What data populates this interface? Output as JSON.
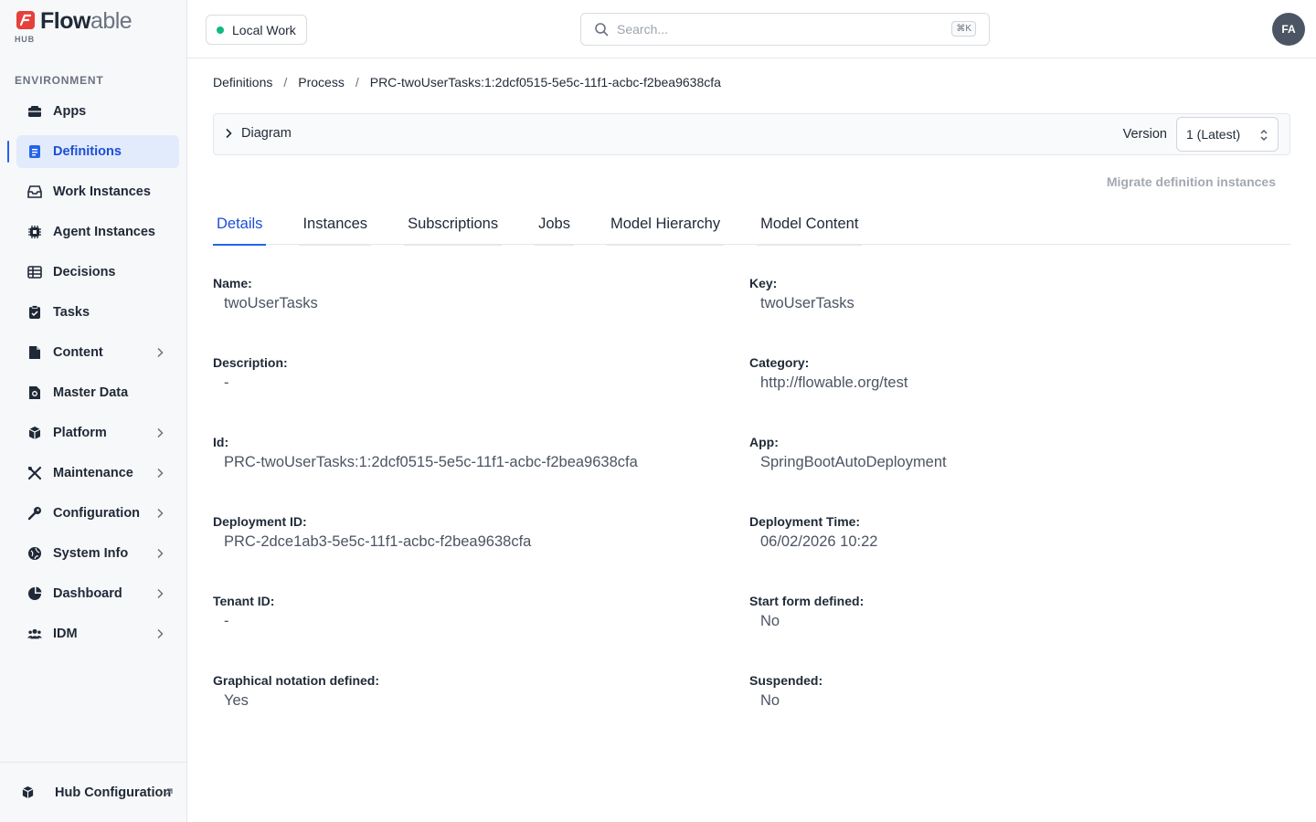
{
  "brand": {
    "name_main": "Flow",
    "name_accent": "able",
    "sub": "HUB"
  },
  "sidebar": {
    "section_label": "ENVIRONMENT",
    "items": [
      {
        "label": "Apps",
        "icon": "apps-icon",
        "active": false,
        "expandable": false
      },
      {
        "label": "Definitions",
        "icon": "definitions-icon",
        "active": true,
        "expandable": false
      },
      {
        "label": "Work Instances",
        "icon": "work-instances-icon",
        "active": false,
        "expandable": false
      },
      {
        "label": "Agent Instances",
        "icon": "agent-instances-icon",
        "active": false,
        "expandable": false
      },
      {
        "label": "Decisions",
        "icon": "decisions-icon",
        "active": false,
        "expandable": false
      },
      {
        "label": "Tasks",
        "icon": "tasks-icon",
        "active": false,
        "expandable": false
      },
      {
        "label": "Content",
        "icon": "content-icon",
        "active": false,
        "expandable": true
      },
      {
        "label": "Master Data",
        "icon": "master-data-icon",
        "active": false,
        "expandable": false
      },
      {
        "label": "Platform",
        "icon": "platform-icon",
        "active": false,
        "expandable": true
      },
      {
        "label": "Maintenance",
        "icon": "maintenance-icon",
        "active": false,
        "expandable": true
      },
      {
        "label": "Configuration",
        "icon": "configuration-icon",
        "active": false,
        "expandable": true
      },
      {
        "label": "System Info",
        "icon": "system-info-icon",
        "active": false,
        "expandable": true
      },
      {
        "label": "Dashboard",
        "icon": "dashboard-icon",
        "active": false,
        "expandable": true
      },
      {
        "label": "IDM",
        "icon": "idm-icon",
        "active": false,
        "expandable": true
      }
    ],
    "footer_label": "Hub Configuration"
  },
  "header": {
    "workspace": "Local Work",
    "search_placeholder": "Search...",
    "search_shortcut": "⌘K",
    "avatar_initials": "FA"
  },
  "breadcrumb": [
    "Definitions",
    "Process",
    "PRC-twoUserTasks:1:2dcf0515-5e5c-11f1-acbc-f2bea9638cfa"
  ],
  "diagram": {
    "label": "Diagram",
    "version_label": "Version",
    "version_value": "1 (Latest)"
  },
  "migrate_label": "Migrate definition instances",
  "tabs": [
    "Details",
    "Instances",
    "Subscriptions",
    "Jobs",
    "Model Hierarchy",
    "Model Content"
  ],
  "active_tab": "Details",
  "details": [
    {
      "label": "Name:",
      "value": "twoUserTasks"
    },
    {
      "label": "Key:",
      "value": "twoUserTasks"
    },
    {
      "label": "Description:",
      "value": "-"
    },
    {
      "label": "Category:",
      "value": "http://flowable.org/test"
    },
    {
      "label": "Id:",
      "value": "PRC-twoUserTasks:1:2dcf0515-5e5c-11f1-acbc-f2bea9638cfa"
    },
    {
      "label": "App:",
      "value": "SpringBootAutoDeployment"
    },
    {
      "label": "Deployment ID:",
      "value": "PRC-2dce1ab3-5e5c-11f1-acbc-f2bea9638cfa"
    },
    {
      "label": "Deployment Time:",
      "value": "06/02/2026 10:22"
    },
    {
      "label": "Tenant ID:",
      "value": "-"
    },
    {
      "label": "Start form defined:",
      "value": "No"
    },
    {
      "label": "Graphical notation defined:",
      "value": "Yes"
    },
    {
      "label": "Suspended:",
      "value": "No"
    }
  ],
  "colors": {
    "accent": "#2563eb",
    "active_bg": "#e2ebfb",
    "brand_red": "#e5403c",
    "status_dot": "#10b981"
  }
}
